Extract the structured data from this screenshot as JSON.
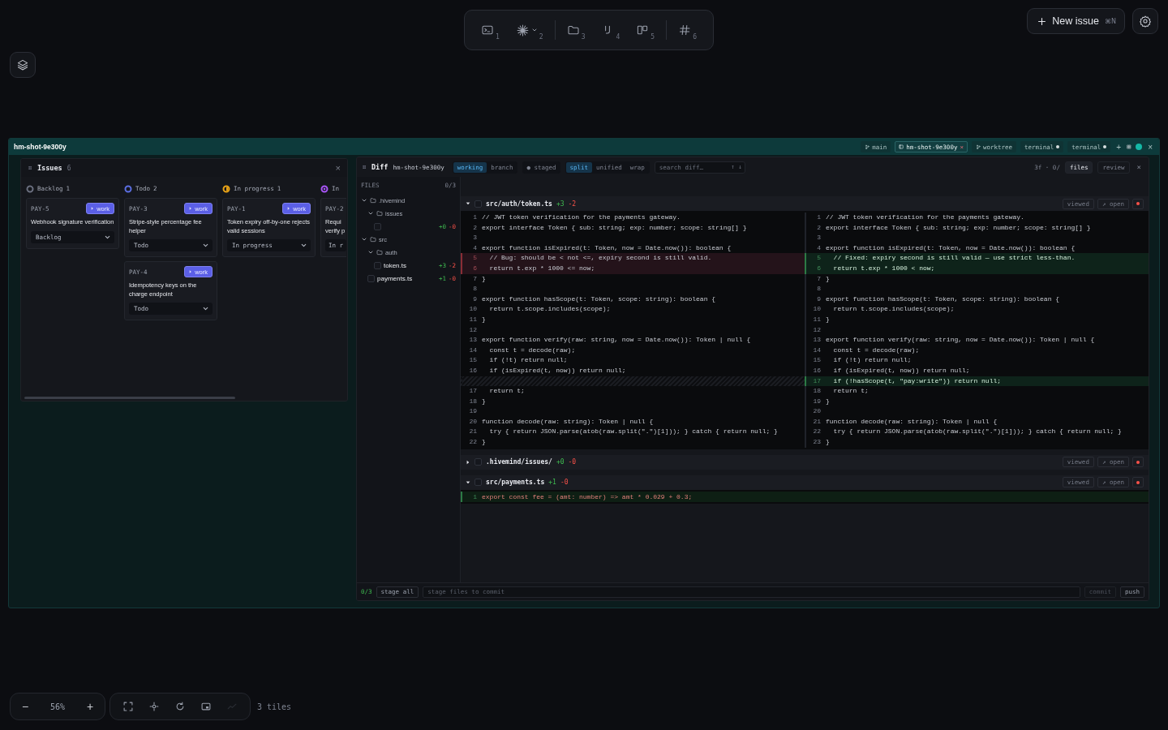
{
  "toolbar": {
    "items": [
      {
        "kind": "terminal",
        "number": "1",
        "has_menu": false,
        "separator_before": false
      },
      {
        "kind": "sparkle",
        "number": "2",
        "has_menu": true,
        "separator_before": false
      },
      {
        "kind": "folder",
        "number": "3",
        "has_menu": false,
        "separator_before": true
      },
      {
        "kind": "hook",
        "number": "4",
        "has_menu": false,
        "separator_before": false
      },
      {
        "kind": "columns",
        "number": "5",
        "has_menu": false,
        "separator_before": false
      },
      {
        "kind": "hash",
        "number": "6",
        "has_menu": false,
        "separator_before": true
      }
    ]
  },
  "new_issue": {
    "label": "New issue",
    "shortcut": "⌘N"
  },
  "window": {
    "title": "hm-shot-9e300y",
    "tabs": [
      {
        "kind": "branch",
        "label": "main",
        "selected": false
      },
      {
        "kind": "tab",
        "label": "hm-shot-9e300y",
        "close": "×",
        "selected": true
      },
      {
        "kind": "worktree",
        "label": "worktree",
        "selected": false
      },
      {
        "kind": "terminal",
        "label": "terminal",
        "selected": false
      },
      {
        "kind": "terminal",
        "label": "terminal",
        "selected": false
      }
    ],
    "add": "+",
    "close": "×"
  },
  "issues": {
    "title": "Issues",
    "count": "6",
    "close": "×",
    "columns": [
      {
        "kind": "backlog",
        "color": "#6b7080",
        "name": "Backlog",
        "count": "1",
        "cards": [
          {
            "id": "PAY-5",
            "action": "work",
            "title": "Webhook signature verification",
            "status": {
              "value": "Backlog",
              "menu": true
            }
          }
        ]
      },
      {
        "kind": "todo",
        "color": "#5b6ee1",
        "name": "Todo",
        "count": "2",
        "cards": [
          {
            "id": "PAY-3",
            "action": "work",
            "title": "Stripe-style percentage fee helper",
            "status": {
              "value": "Todo",
              "menu": true
            }
          },
          {
            "id": "PAY-4",
            "action": "work",
            "title": "Idempotency keys on the charge endpoint",
            "status": {
              "value": "Todo",
              "menu": true
            }
          }
        ]
      },
      {
        "kind": "progress",
        "color": "#e8a317",
        "name": "In progress",
        "count": "1",
        "cards": [
          {
            "id": "PAY-1",
            "action": "work",
            "title": "Token expiry off-by-one rejects valid sessions",
            "status": {
              "value": "In progress",
              "menu": true
            }
          }
        ]
      },
      {
        "kind": "review",
        "color": "#a855f7",
        "name": "In",
        "cards": [
          {
            "id": "PAY-2",
            "title": "Requi verify p",
            "status": {
              "value": "In r",
              "menu": false
            }
          }
        ]
      }
    ]
  },
  "diff": {
    "title": "Diff",
    "branch": "hm-shot-9e300y",
    "source_tabs": [
      {
        "label": "working",
        "selected": true
      },
      {
        "label": "branch",
        "selected": false
      }
    ],
    "staged": "● staged",
    "view_tabs": [
      {
        "label": "split",
        "selected": true
      },
      {
        "label": "unified",
        "selected": false
      },
      {
        "label": "wrap",
        "selected": false
      }
    ],
    "search": {
      "placeholder": "search diff…",
      "nav": "↑ ↓"
    },
    "summary": "3f · 0/",
    "panel_tabs": [
      {
        "label": "files",
        "selected": true
      },
      {
        "label": "review",
        "selected": false
      }
    ],
    "close": "×",
    "files": {
      "heading": "FILES",
      "count": "0/3",
      "tree": [
        {
          "kind": "folder",
          "name": ".hivemind",
          "expanded": true,
          "children": [
            {
              "kind": "folder",
              "name": "issues",
              "expanded": true,
              "children": [
                {
                  "kind": "file",
                  "checked": false,
                  "added": "+0",
                  "removed": "-0"
                }
              ]
            }
          ]
        },
        {
          "kind": "folder",
          "name": "src",
          "expanded": true,
          "children": [
            {
              "kind": "folder",
              "name": "auth",
              "expanded": true,
              "children": [
                {
                  "kind": "file",
                  "name": "token.ts",
                  "checked": false,
                  "added": "+3",
                  "removed": "-2"
                }
              ]
            },
            {
              "kind": "file",
              "name": "payments.ts",
              "checked": false,
              "added": "+1",
              "removed": "-0"
            }
          ]
        }
      ]
    },
    "sections": [
      {
        "path": "src/auth/token.ts",
        "added": "+3",
        "removed": "-2",
        "expanded": true,
        "checked": false,
        "viewed": "viewed",
        "open": "↗ open",
        "rows": [
          {
            "l": {
              "kind": "same",
              "n": "1",
              "t": "// JWT token verification for the payments gateway."
            },
            "r": {
              "kind": "same",
              "n": "1",
              "t": "// JWT token verification for the payments gateway."
            }
          },
          {
            "l": {
              "kind": "same",
              "n": "2",
              "t": "export interface Token { sub: string; exp: number; scope: string[] }"
            },
            "r": {
              "kind": "same",
              "n": "2",
              "t": "export interface Token { sub: string; exp: number; scope: string[] }"
            }
          },
          {
            "l": {
              "kind": "same",
              "n": "3"
            },
            "r": {
              "kind": "same",
              "n": "3"
            }
          },
          {
            "l": {
              "kind": "same",
              "n": "4",
              "t": "export function isExpired(t: Token, now = Date.now()): boolean {"
            },
            "r": {
              "kind": "same",
              "n": "4",
              "t": "export function isExpired(t: Token, now = Date.now()): boolean {"
            }
          },
          {
            "l": {
              "kind": "removed",
              "n": "5",
              "t": "  // Bug: should be < not <=, expiry second is still valid."
            },
            "r": {
              "kind": "added",
              "n": "5",
              "t": "  // Fixed: expiry second is still valid — use strict less-than."
            }
          },
          {
            "l": {
              "kind": "removed",
              "n": "6",
              "t": "  return t.exp * 1000 <= now;"
            },
            "r": {
              "kind": "added",
              "n": "6",
              "t": "  return t.exp * 1000 < now;"
            }
          },
          {
            "l": {
              "kind": "same",
              "n": "7",
              "t": "}"
            },
            "r": {
              "kind": "same",
              "n": "7",
              "t": "}"
            }
          },
          {
            "l": {
              "kind": "same",
              "n": "8"
            },
            "r": {
              "kind": "same",
              "n": "8"
            }
          },
          {
            "l": {
              "kind": "same",
              "n": "9",
              "t": "export function hasScope(t: Token, scope: string): boolean {"
            },
            "r": {
              "kind": "same",
              "n": "9",
              "t": "export function hasScope(t: Token, scope: string): boolean {"
            }
          },
          {
            "l": {
              "kind": "same",
              "n": "10",
              "t": "  return t.scope.includes(scope);"
            },
            "r": {
              "kind": "same",
              "n": "10",
              "t": "  return t.scope.includes(scope);"
            }
          },
          {
            "l": {
              "kind": "same",
              "n": "11",
              "t": "}"
            },
            "r": {
              "kind": "same",
              "n": "11",
              "t": "}"
            }
          },
          {
            "l": {
              "kind": "same",
              "n": "12"
            },
            "r": {
              "kind": "same",
              "n": "12"
            }
          },
          {
            "l": {
              "kind": "same",
              "n": "13",
              "t": "export function verify(raw: string, now = Date.now()): Token | null {"
            },
            "r": {
              "kind": "same",
              "n": "13",
              "t": "export function verify(raw: string, now = Date.now()): Token | null {"
            }
          },
          {
            "l": {
              "kind": "same",
              "n": "14",
              "t": "  const t = decode(raw);"
            },
            "r": {
              "kind": "same",
              "n": "14",
              "t": "  const t = decode(raw);"
            }
          },
          {
            "l": {
              "kind": "same",
              "n": "15",
              "t": "  if (!t) return null;"
            },
            "r": {
              "kind": "same",
              "n": "15",
              "t": "  if (!t) return null;"
            }
          },
          {
            "l": {
              "kind": "same",
              "n": "16",
              "t": "  if (isExpired(t, now)) return null;"
            },
            "r": {
              "kind": "same",
              "n": "16",
              "t": "  if (isExpired(t, now)) return null;"
            }
          },
          {
            "l": {
              "kind": "empty"
            },
            "r": {
              "kind": "added",
              "n": "17",
              "t": "  if (!hasScope(t, \"pay:write\")) return null;"
            }
          },
          {
            "l": {
              "kind": "same",
              "n": "17",
              "t": "  return t;"
            },
            "r": {
              "kind": "same",
              "n": "18",
              "t": "  return t;"
            }
          },
          {
            "l": {
              "kind": "same",
              "n": "18",
              "t": "}"
            },
            "r": {
              "kind": "same",
              "n": "19",
              "t": "}"
            }
          },
          {
            "l": {
              "kind": "same",
              "n": "19"
            },
            "r": {
              "kind": "same",
              "n": "20"
            }
          },
          {
            "l": {
              "kind": "same",
              "n": "20",
              "t": "function decode(raw: string): Token | null {"
            },
            "r": {
              "kind": "same",
              "n": "21",
              "t": "function decode(raw: string): Token | null {"
            }
          },
          {
            "l": {
              "kind": "same",
              "n": "21",
              "t": "  try { return JSON.parse(atob(raw.split(\".\")[1])); } catch { return null; }"
            },
            "r": {
              "kind": "same",
              "n": "22",
              "t": "  try { return JSON.parse(atob(raw.split(\".\")[1])); } catch { return null; }"
            }
          },
          {
            "l": {
              "kind": "same",
              "n": "22",
              "t": "}"
            },
            "r": {
              "kind": "same",
              "n": "23",
              "t": "}"
            }
          }
        ]
      },
      {
        "path": ".hivemind/issues/",
        "added": "+0",
        "removed": "-0",
        "expanded": false,
        "checked": false,
        "viewed": "viewed",
        "open": "↗ open"
      },
      {
        "path": "src/payments.ts",
        "added": "+1",
        "removed": "-0",
        "expanded": true,
        "checked": false,
        "viewed": "viewed",
        "open": "↗ open",
        "lines": [
          {
            "kind": "added",
            "n": "1",
            "t": "export const fee = (amt: number) => amt * 0.029 + 0.3;"
          }
        ]
      }
    ],
    "footer": {
      "count": "0/3",
      "stage_all": "stage all",
      "placeholder": "stage files to commit",
      "commit": {
        "label": "commit",
        "disabled": true
      },
      "push": "push"
    }
  },
  "canvas": {
    "zoom": {
      "minus": "−",
      "value": "56%",
      "plus": "+"
    },
    "tools": [
      {
        "kind": "fit",
        "disabled": false
      },
      {
        "kind": "center",
        "disabled": false
      },
      {
        "kind": "reset",
        "disabled": false
      },
      {
        "kind": "minimap",
        "disabled": false
      },
      {
        "kind": "trend",
        "disabled": true
      }
    ],
    "tiles": "3 tiles"
  }
}
